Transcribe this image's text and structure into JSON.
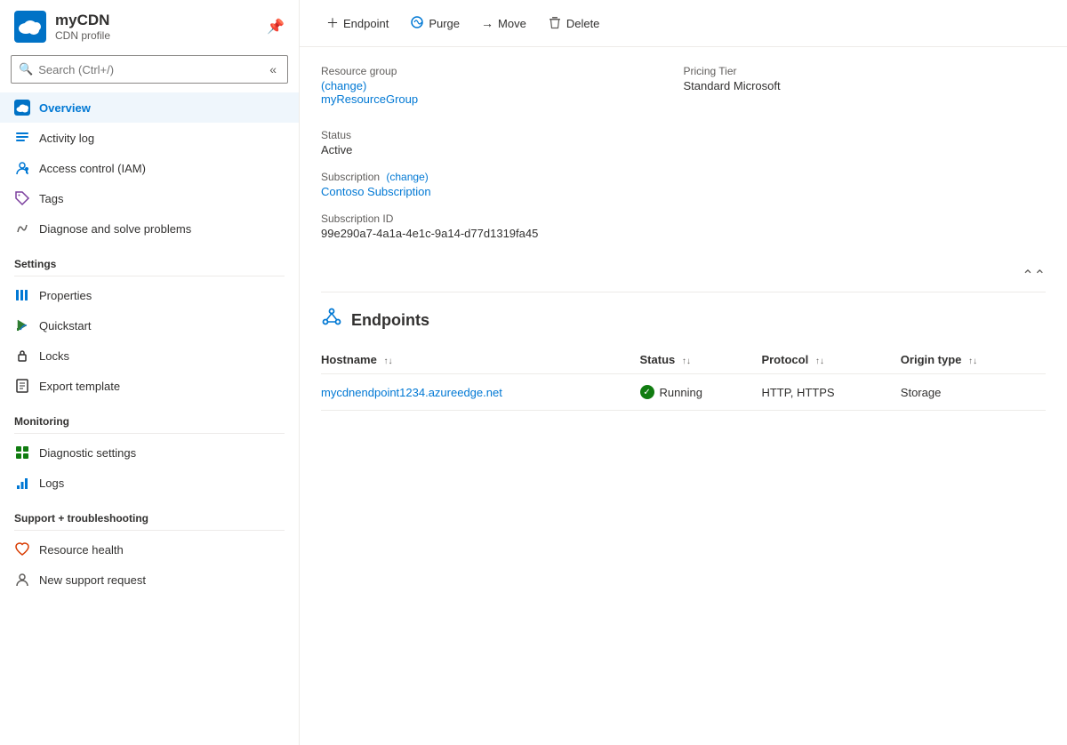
{
  "sidebar": {
    "app_title": "myCDN",
    "app_subtitle": "CDN profile",
    "search_placeholder": "Search (Ctrl+/)",
    "collapse_symbol": "«",
    "nav_items": [
      {
        "id": "overview",
        "label": "Overview",
        "icon": "cloud",
        "active": true,
        "section": null
      },
      {
        "id": "activity-log",
        "label": "Activity log",
        "icon": "list",
        "active": false,
        "section": null
      },
      {
        "id": "access-control",
        "label": "Access control (IAM)",
        "icon": "person-shield",
        "active": false,
        "section": null
      },
      {
        "id": "tags",
        "label": "Tags",
        "icon": "tag",
        "active": false,
        "section": null
      },
      {
        "id": "diagnose",
        "label": "Diagnose and solve problems",
        "icon": "wrench",
        "active": false,
        "section": null
      }
    ],
    "settings_section": "Settings",
    "settings_items": [
      {
        "id": "properties",
        "label": "Properties",
        "icon": "bars"
      },
      {
        "id": "quickstart",
        "label": "Quickstart",
        "icon": "lightning"
      },
      {
        "id": "locks",
        "label": "Locks",
        "icon": "lock"
      },
      {
        "id": "export-template",
        "label": "Export template",
        "icon": "download"
      }
    ],
    "monitoring_section": "Monitoring",
    "monitoring_items": [
      {
        "id": "diagnostic-settings",
        "label": "Diagnostic settings",
        "icon": "chart"
      },
      {
        "id": "logs",
        "label": "Logs",
        "icon": "bar-chart"
      }
    ],
    "support_section": "Support + troubleshooting",
    "support_items": [
      {
        "id": "resource-health",
        "label": "Resource health",
        "icon": "heart"
      },
      {
        "id": "new-support-request",
        "label": "New support request",
        "icon": "person"
      }
    ]
  },
  "toolbar": {
    "endpoint_label": "Endpoint",
    "purge_label": "Purge",
    "move_label": "Move",
    "delete_label": "Delete"
  },
  "overview": {
    "resource_group_label": "Resource group",
    "resource_group_change": "(change)",
    "resource_group_value": "myResourceGroup",
    "pricing_tier_label": "Pricing Tier",
    "pricing_tier_value": "Standard Microsoft",
    "status_label": "Status",
    "status_value": "Active",
    "subscription_label": "Subscription",
    "subscription_change": "(change)",
    "subscription_value": "Contoso Subscription",
    "subscription_id_label": "Subscription ID",
    "subscription_id_value": "99e290a7-4a1a-4e1c-9a14-d77d1319fa45"
  },
  "endpoints": {
    "section_title": "Endpoints",
    "columns": [
      {
        "id": "hostname",
        "label": "Hostname"
      },
      {
        "id": "status",
        "label": "Status"
      },
      {
        "id": "protocol",
        "label": "Protocol"
      },
      {
        "id": "origin_type",
        "label": "Origin type"
      }
    ],
    "rows": [
      {
        "hostname": "mycdnendpoint1234.azureedge.net",
        "status": "Running",
        "protocol": "HTTP, HTTPS",
        "origin_type": "Storage"
      }
    ]
  }
}
